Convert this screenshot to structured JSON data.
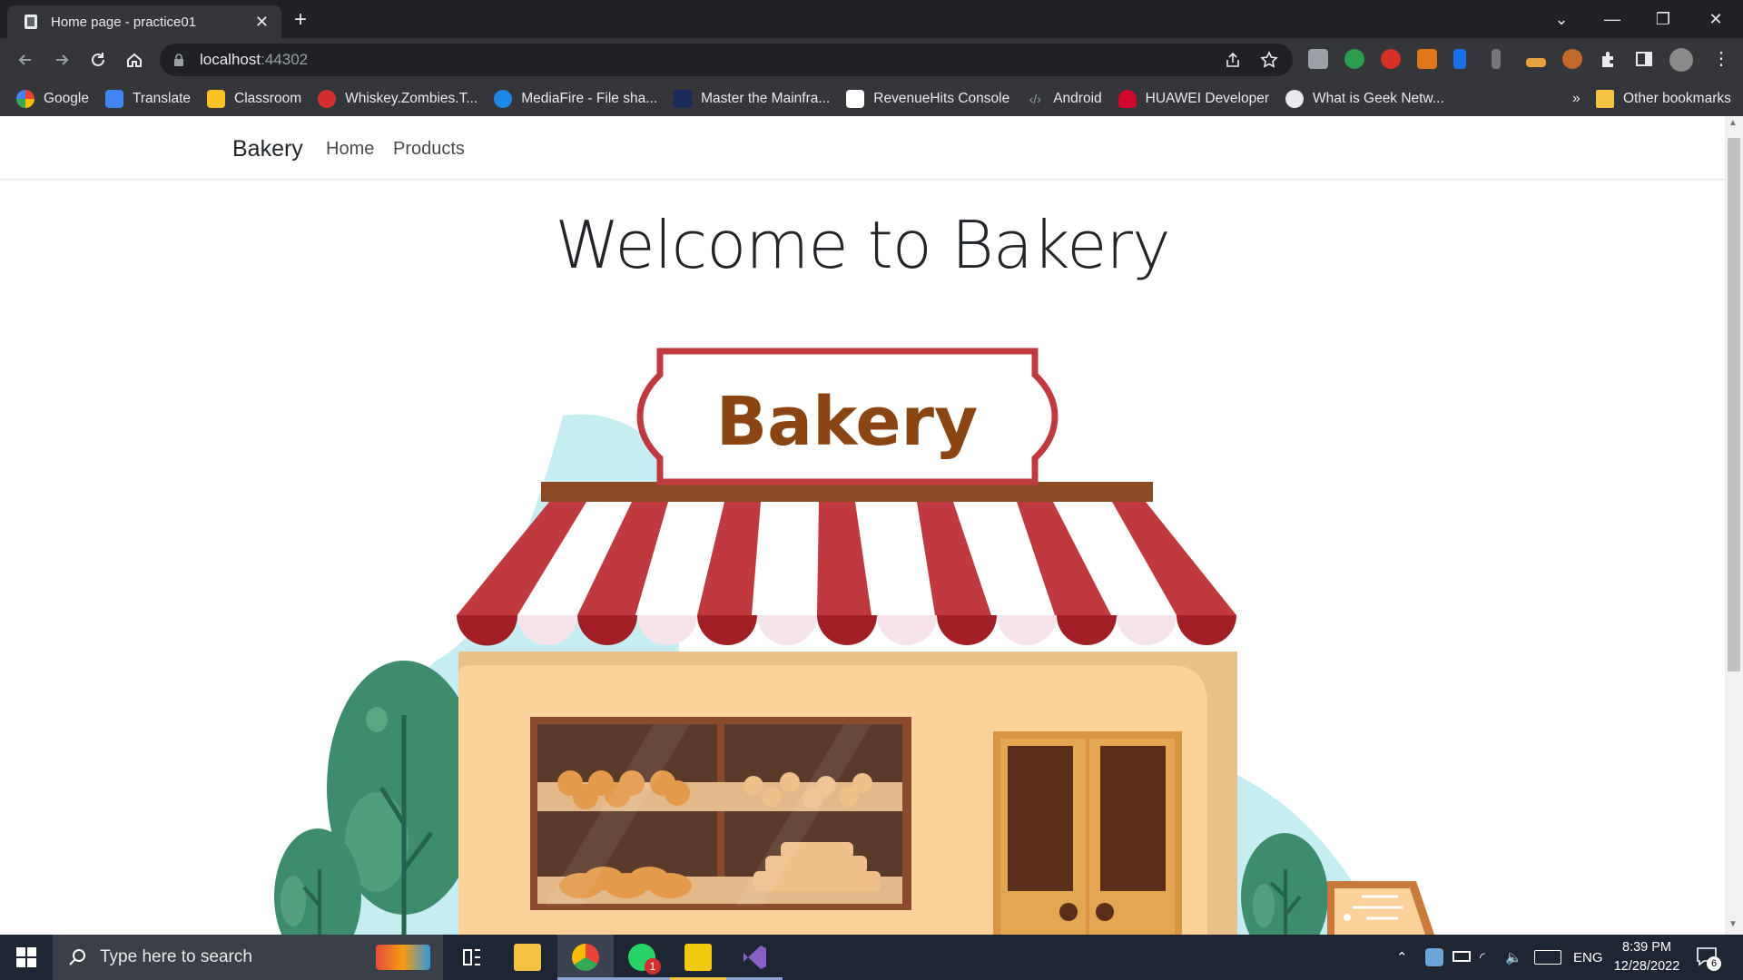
{
  "browser": {
    "tab_title": "Home page - practice01",
    "close_glyph": "✕",
    "new_tab_glyph": "+",
    "url_host": "localhost",
    "url_port": ":44302",
    "window_controls": [
      "⌄",
      "—",
      "❐",
      "✕"
    ]
  },
  "bookmarks": {
    "items": [
      "Google",
      "Translate",
      "Classroom",
      "Whiskey.Zombies.T...",
      "MediaFire - File sha...",
      "Master the Mainfra...",
      "RevenueHits Console",
      "Android",
      "HUAWEI Developer",
      "What is Geek Netw..."
    ],
    "overflow": "»",
    "other": "Other bookmarks"
  },
  "site": {
    "brand": "Bakery",
    "nav": [
      "Home",
      "Products"
    ],
    "heading": "Welcome to Bakery",
    "sign_text": "Bakery"
  },
  "taskbar": {
    "search_placeholder": "Type here to search",
    "lang": "ENG",
    "time": "8:39 PM",
    "date": "12/28/2022",
    "notif_count": "6",
    "whatsapp_badge": "1"
  },
  "colors": {
    "awning_red": "#c0393f",
    "sign_brown": "#8b4513",
    "wall_peach": "#fcd29b",
    "tree_green": "#3e8c6e",
    "sky_blue": "#c5edf2"
  }
}
